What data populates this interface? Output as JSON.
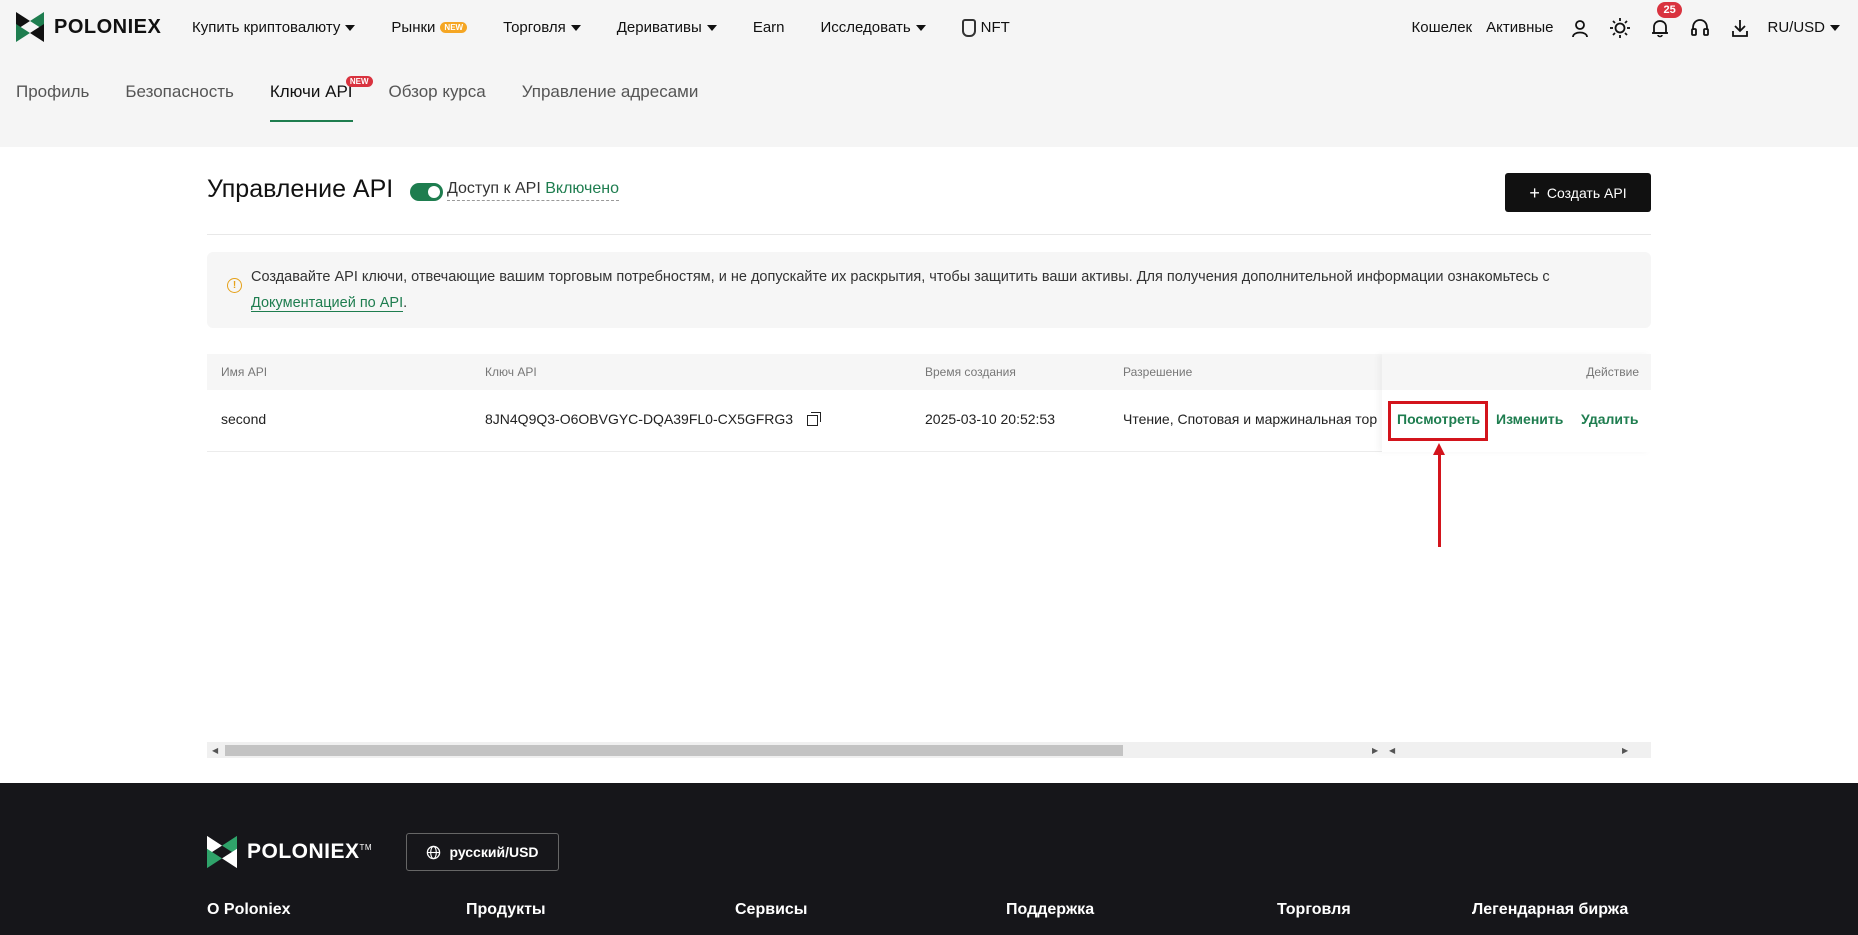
{
  "brand": {
    "name": "POLONIEX",
    "green": "#1e7d4f",
    "red": "#d9333f"
  },
  "nav": {
    "items": [
      {
        "label": "Купить криптовалюту",
        "caret": true
      },
      {
        "label": "Рынки",
        "badge": "NEW"
      },
      {
        "label": "Торговля",
        "caret": true
      },
      {
        "label": "Деривативы",
        "caret": true
      },
      {
        "label": "Earn"
      },
      {
        "label": "Исследовать",
        "caret": true
      },
      {
        "label": "NFT",
        "icon": "nft-icon"
      }
    ],
    "wallet": "Кошелек",
    "assets": "Активные",
    "notifications_count": "25",
    "locale": "RU/USD"
  },
  "subtabs": [
    {
      "label": "Профиль"
    },
    {
      "label": "Безопасность"
    },
    {
      "label": "Ключи API",
      "badge": "NEW",
      "active": true
    },
    {
      "label": "Обзор курса"
    },
    {
      "label": "Управление адресами"
    }
  ],
  "section": {
    "title": "Управление API",
    "access_label": "Доступ к API",
    "access_status": "Включено",
    "create_button": "Создать API"
  },
  "notice": {
    "text": "Создавайте API ключи, отвечающие вашим торговым потребностям, и не допускайте их раскрытия, чтобы защитить ваши активы. Для получения дополнительной информации ознакомьтесь с",
    "link": "Документацией по API",
    "suffix": "."
  },
  "table": {
    "headers": {
      "name": "Имя API",
      "key": "Ключ API",
      "created": "Время создания",
      "permission": "Разрешение",
      "action": "Действие"
    },
    "rows": [
      {
        "name": "second",
        "key": "8JN4Q9Q3-O6OBVGYC-DQA39FL0-CX5GFRG3",
        "created": "2025-03-10 20:52:53",
        "permission": "Чтение, Спотовая и маржинальная тор",
        "actions": {
          "view": "Посмотреть",
          "edit": "Изменить",
          "delete": "Удалить"
        }
      }
    ]
  },
  "footer": {
    "logo": "POLONIEX",
    "tm": "TM",
    "language_button": "русский/USD",
    "columns": [
      "О Poloniex",
      "Продукты",
      "Сервисы",
      "Поддержка",
      "Торговля",
      "Легендарная биржа"
    ]
  }
}
